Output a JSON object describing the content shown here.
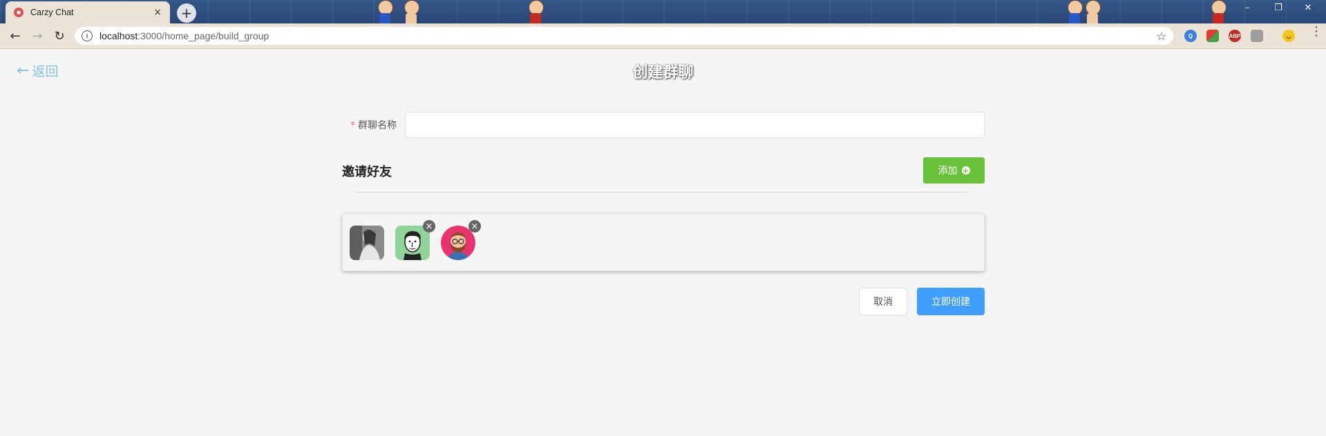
{
  "browser": {
    "tab_title": "Carzy Chat",
    "tab_close": "×",
    "new_tab": "+",
    "url_host": "localhost",
    "url_path": ":3000/home_page/build_group",
    "ext_abp_label": "ABP"
  },
  "page": {
    "back_label": "返回",
    "title": "创建群聊",
    "form": {
      "group_name_label": "群聊名称",
      "required_mark": "*",
      "group_name_value": ""
    },
    "invite_title": "邀请好友",
    "add_button_label": "添加",
    "friends": [
      {
        "id": "friend-1",
        "removable": false
      },
      {
        "id": "friend-2",
        "removable": true
      },
      {
        "id": "friend-3",
        "removable": true
      }
    ],
    "cancel_label": "取消",
    "create_label": "立即创建"
  },
  "colors": {
    "back_link": "#7dc4e6",
    "add_button": "#67c23a",
    "create_button": "#409eff",
    "required": "#f56c6c"
  }
}
